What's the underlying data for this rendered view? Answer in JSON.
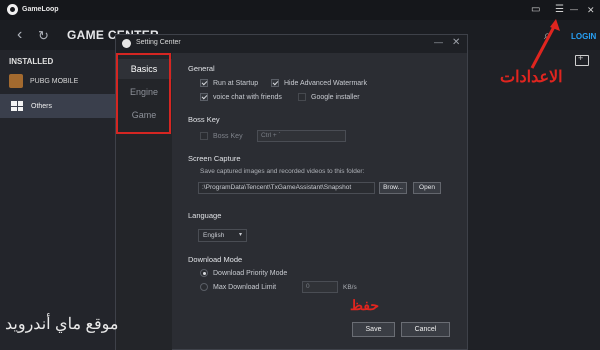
{
  "app": {
    "logo_text": "GameLoop",
    "nav_title": "GAME CENTER",
    "login": "LOGIN",
    "window_controls": {
      "skin": "▭",
      "menu": "☰",
      "minimize": "—",
      "close": "✕"
    }
  },
  "sidebar": {
    "heading": "INSTALLED",
    "items": [
      {
        "label": "PUBG MOBILE"
      },
      {
        "label": "Others"
      }
    ]
  },
  "overlay": {
    "watermark": "موقع ماي أندرويد",
    "settings_label": "الاعدادات",
    "save_label": "حفظ"
  },
  "dialog": {
    "title": "Setting Center",
    "nav": [
      "Basics",
      "Engine",
      "Game"
    ],
    "general": {
      "title": "General",
      "run_at_startup": "Run at Startup",
      "hide_watermark": "Hide Advanced Watermark",
      "voice_chat": "voice chat with friends",
      "google_installer": "Google installer"
    },
    "boss_key": {
      "title": "Boss Key",
      "label": "Boss Key",
      "shortcut": "Ctrl + `"
    },
    "screen_capture": {
      "title": "Screen Capture",
      "description": "Save captured images and recorded videos to this folder:",
      "path": ":\\ProgramData\\Tencent\\TxGameAssistant\\Snapshot",
      "browse": "Brow...",
      "open": "Open"
    },
    "language": {
      "title": "Language",
      "selected": "English"
    },
    "download": {
      "title": "Download Mode",
      "priority": "Download Priority Mode",
      "limit": "Max Download Limit",
      "limit_value": "0",
      "unit": "KB/s"
    },
    "buttons": {
      "save": "Save",
      "cancel": "Cancel"
    }
  }
}
